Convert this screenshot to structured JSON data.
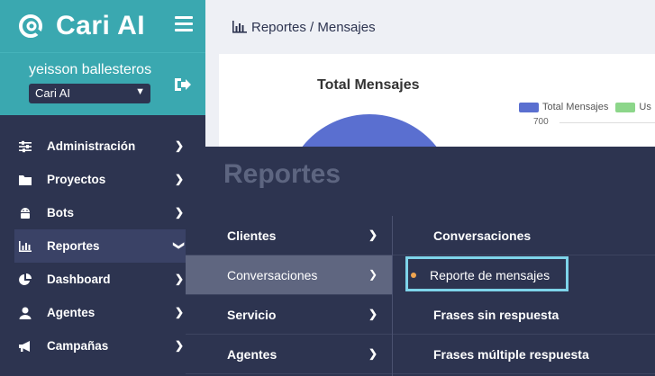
{
  "brand": {
    "name": "Cari AI"
  },
  "user": {
    "name": "yeisson ballesteros",
    "company_selected": "Cari AI"
  },
  "sidebar": {
    "items": [
      {
        "label": "Administración",
        "icon": "sliders-icon"
      },
      {
        "label": "Proyectos",
        "icon": "folder-icon"
      },
      {
        "label": "Bots",
        "icon": "android-icon"
      },
      {
        "label": "Reportes",
        "icon": "bar-chart-icon",
        "active": true
      },
      {
        "label": "Dashboard",
        "icon": "pie-chart-icon"
      },
      {
        "label": "Agentes",
        "icon": "user-icon"
      },
      {
        "label": "Campañas",
        "icon": "megaphone-icon"
      }
    ]
  },
  "breadcrumb": {
    "text": "Reportes / Mensajes"
  },
  "chart": {
    "title": "Total Mensajes",
    "legend": [
      {
        "label": "Total Mensajes",
        "color": "#5a6fd0"
      },
      {
        "label": "Us",
        "color": "#8cd68a"
      }
    ],
    "ytick": "700"
  },
  "megamenu": {
    "title": "Reportes",
    "column1": [
      "Clientes",
      "Conversaciones",
      "Servicio",
      "Agentes"
    ],
    "column1_selected": "Conversaciones",
    "column2": [
      "Conversaciones",
      "Reporte de mensajes",
      "Frases sin respuesta",
      "Frases múltiple respuesta"
    ],
    "column2_selected": "Reporte de mensajes"
  },
  "colors": {
    "accent": "#3aa8b0",
    "sidebar": "#2d3450",
    "highlight": "#7ed4ea",
    "bullet": "#f0a550"
  }
}
